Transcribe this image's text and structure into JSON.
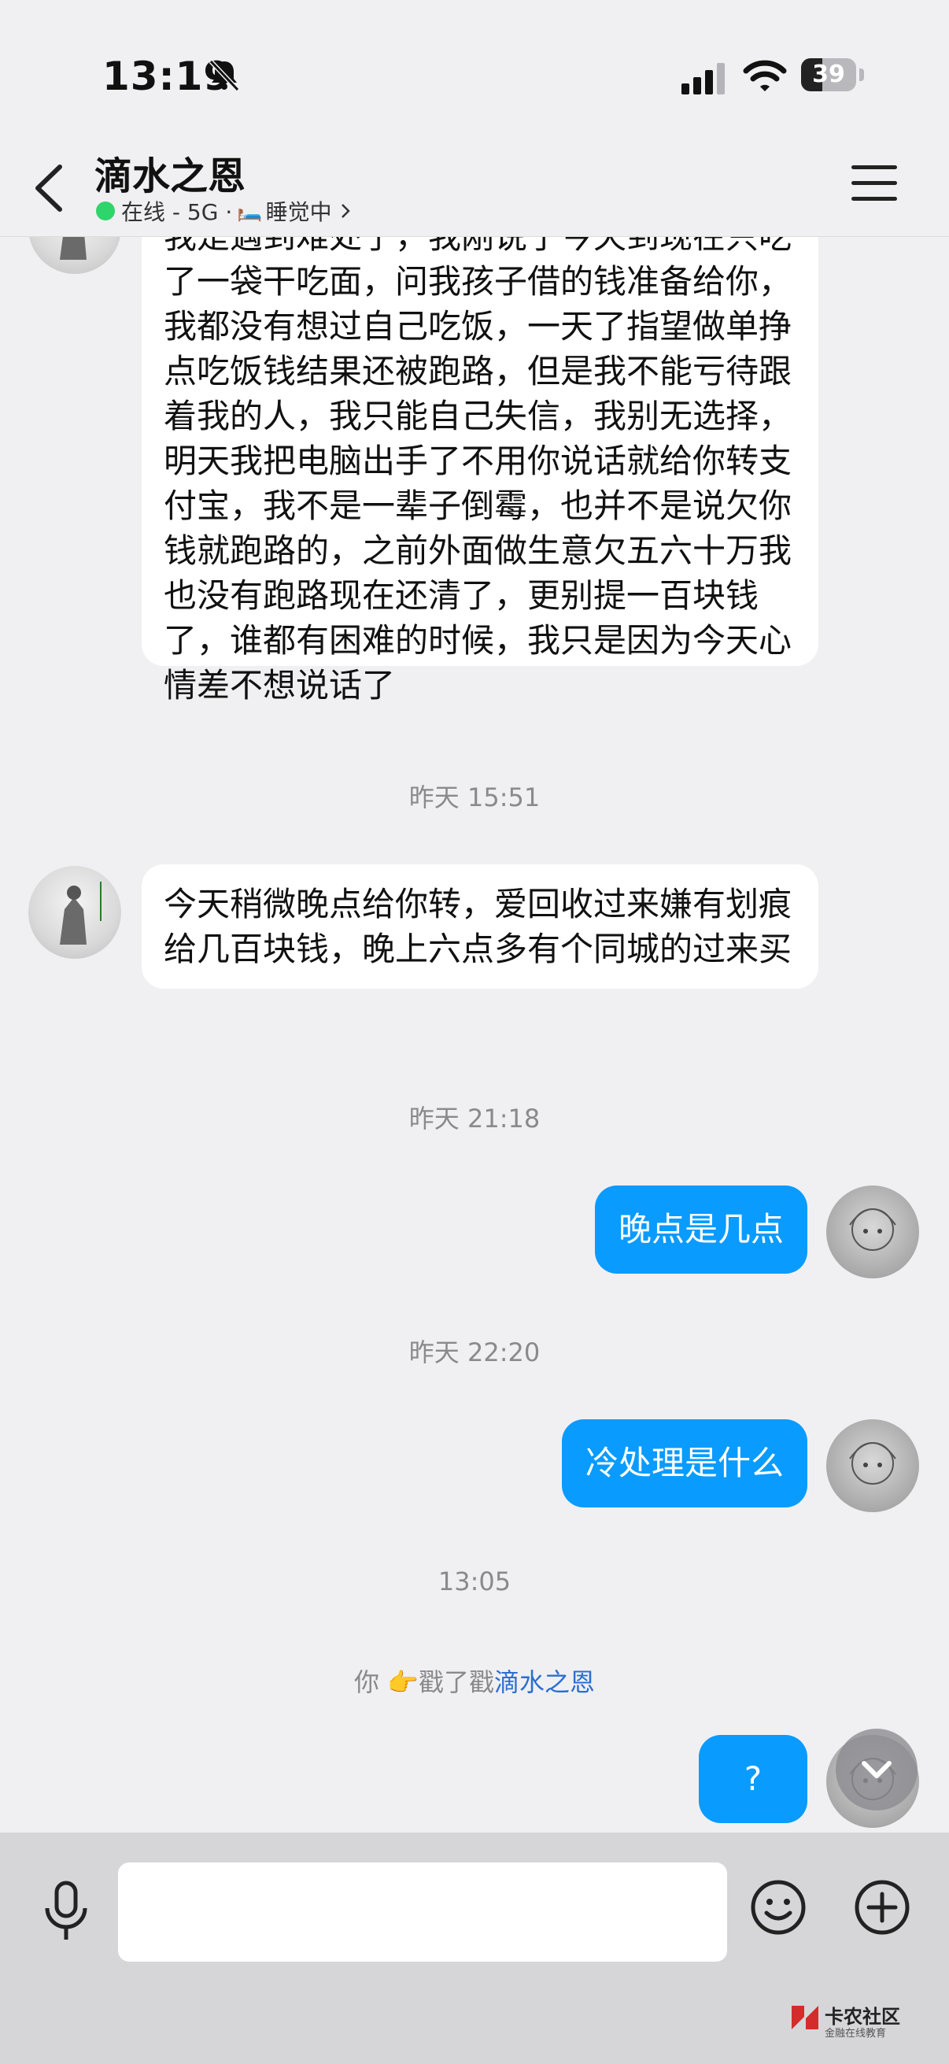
{
  "status_bar": {
    "time": "13:19",
    "battery": "39",
    "battery_level": 0.39
  },
  "header": {
    "contact_name": "滴水之恩",
    "presence_status": "在线 - 5G · ",
    "activity": "睡觉中",
    "icons": {
      "back": "chevron-left-icon",
      "menu": "hamburger-menu-icon",
      "bed": "🛏️"
    }
  },
  "messages": [
    {
      "side": "left",
      "text": "我是遇到难处了，我刚说了今天到现在只吃了一袋干吃面，问我孩子借的钱准备给你，我都没有想过自己吃饭，一天了指望做单挣点吃饭钱结果还被跑路，但是我不能亏待跟着我的人，我只能自己失信，我别无选择，明天我把电脑出手了不用你说话就给你转支付宝，我不是一辈子倒霉，也并不是说欠你钱就跑路的，之前外面做生意欠五六十万我也没有跑路现在还清了，更别提一百块钱了，谁都有困难的时候，我只是因为今天心情差不想说话了"
    },
    {
      "timestamp": "昨天 15:51"
    },
    {
      "side": "left",
      "text": "今天稍微晚点给你转，爱回收过来嫌有划痕给几百块钱，晚上六点多有个同城的过来买"
    },
    {
      "timestamp": "昨天 21:18"
    },
    {
      "side": "right",
      "text": "晚点是几点"
    },
    {
      "timestamp": "昨天 22:20"
    },
    {
      "side": "right",
      "text": "冷处理是什么"
    },
    {
      "timestamp": "13:05"
    },
    {
      "system": true,
      "prefix": "你 ",
      "emoji": "👉",
      "middle": "戳了戳",
      "name": "滴水之恩"
    },
    {
      "side": "right",
      "text": "?"
    }
  ],
  "input_bar": {
    "placeholder": "",
    "icons": {
      "voice": "microphone-icon",
      "emoji": "smiley-icon",
      "more": "plus-circle-icon"
    }
  },
  "watermark": {
    "title": "卡农社区",
    "subtitle": "金融在线教育"
  }
}
